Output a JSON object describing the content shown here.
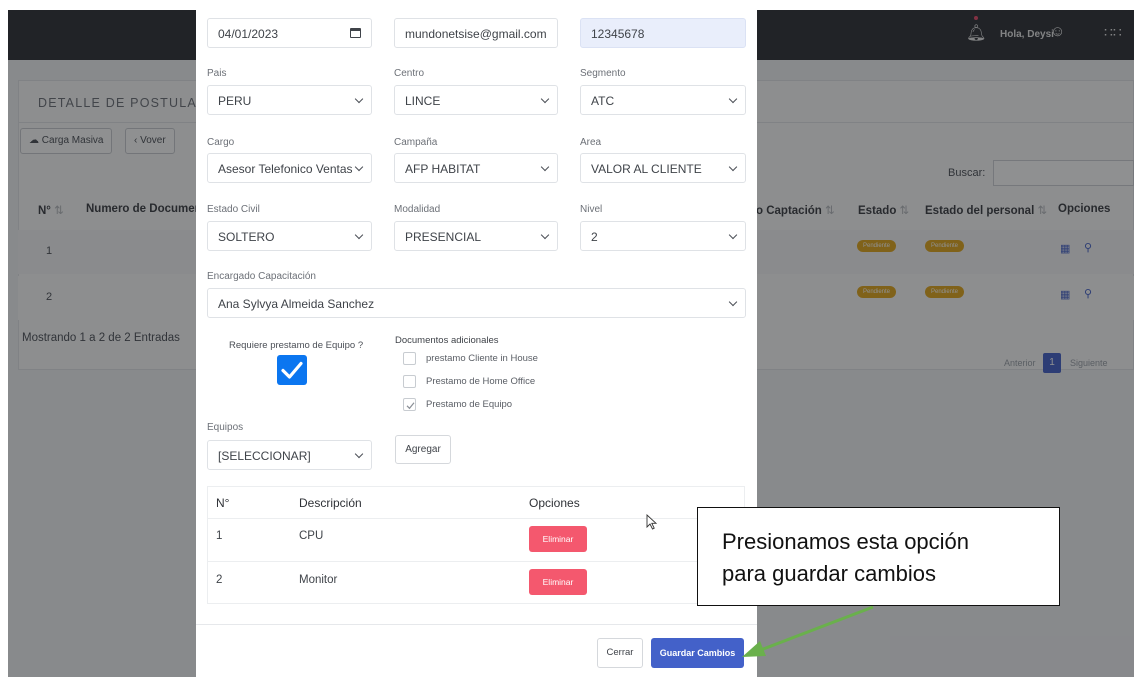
{
  "background": {
    "topbar": {
      "greeting": "Hola, Deysi",
      "icons": [
        "bell-icon",
        "user-circle-icon",
        "apps-grid-icon"
      ]
    },
    "page_title": "DETALLE DE POSTULA",
    "buttons": {
      "carga_masiva": "Carga Masiva",
      "volver": "Vover"
    },
    "search_label": "Buscar:",
    "columns": [
      "N°",
      "Numero de Document",
      "o Captación",
      "Estado",
      "Estado del personal",
      "Opciones"
    ],
    "rows": [
      {
        "n": "1",
        "estado": "Pendiente",
        "estado_personal": "Pendiente"
      },
      {
        "n": "2",
        "estado": "Pendiente",
        "estado_personal": "Pendiente"
      }
    ],
    "summary": "Mostrando 1 a 2 de 2 Entradas",
    "pager": {
      "prev": "Anterior",
      "page": "1",
      "next": "Siguiente"
    }
  },
  "form": {
    "fecha": "04/01/2023",
    "email": "mundonetsise@gmail.com",
    "telefono": "12345678",
    "pais": {
      "label": "Pais",
      "value": "PERU"
    },
    "centro": {
      "label": "Centro",
      "value": "LINCE"
    },
    "segmento": {
      "label": "Segmento",
      "value": "ATC"
    },
    "cargo": {
      "label": "Cargo",
      "value": "Asesor Telefonico Ventas"
    },
    "campana": {
      "label": "Campaña",
      "value": "AFP HABITAT"
    },
    "area": {
      "label": "Area",
      "value": "VALOR AL CLIENTE"
    },
    "estado_civil": {
      "label": "Estado Civil",
      "value": "SOLTERO"
    },
    "modalidad": {
      "label": "Modalidad",
      "value": "PRESENCIAL"
    },
    "nivel": {
      "label": "Nivel",
      "value": "2"
    },
    "encargado": {
      "label": "Encargado Capacitación",
      "value": "Ana Sylvya Almeida Sanchez"
    },
    "requiere_prestamo": {
      "label": "Requiere prestamo de Equipo ?",
      "checked": true
    },
    "documentos": {
      "label": "Documentos adicionales",
      "items": [
        {
          "label": "prestamo Cliente in House",
          "checked": false
        },
        {
          "label": "Prestamo de Home Office",
          "checked": false
        },
        {
          "label": "Prestamo de Equipo",
          "checked": true
        }
      ]
    },
    "equipos": {
      "label": "Equipos",
      "value": "[SELECCIONAR]"
    },
    "agregar_label": "Agregar"
  },
  "equipos_table": {
    "headers": {
      "n": "N°",
      "descripcion": "Descripción",
      "opciones": "Opciones"
    },
    "rows": [
      {
        "n": "1",
        "descripcion": "CPU",
        "action": "Eliminar"
      },
      {
        "n": "2",
        "descripcion": "Monitor",
        "action": "Eliminar"
      }
    ]
  },
  "footer": {
    "cerrar": "Cerrar",
    "guardar": "Guardar Cambios"
  },
  "annotation": {
    "line1": "Presionamos esta opción",
    "line2": "para guardar cambios",
    "arrow_color": "#6ab04c"
  },
  "colors": {
    "primary": "#4361c9",
    "danger": "#f4586e",
    "pending": "#e3a81c",
    "check": "#0b76f0"
  }
}
